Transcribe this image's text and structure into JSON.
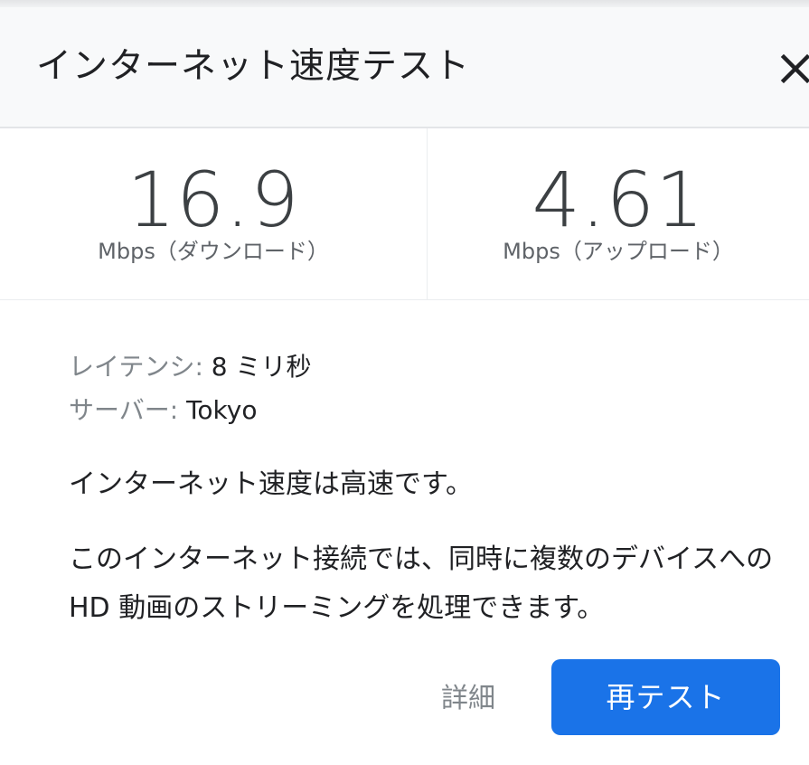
{
  "dialog": {
    "title": "インターネット速度テスト",
    "close_icon": "close-icon"
  },
  "results": {
    "download": {
      "value": "16.9",
      "unit_label": "Mbps（ダウンロード）"
    },
    "upload": {
      "value": "4.61",
      "unit_label": "Mbps（アップロード）"
    }
  },
  "info": {
    "latency_label": "レイテンシ: ",
    "latency_value": "8 ミリ秒",
    "server_label": "サーバー: ",
    "server_value": "Tokyo"
  },
  "verdict": "インターネット速度は高速です。",
  "description": "このインターネット接続では、同時に複数のデバイスへの HD 動画のストリーミングを処理できます。",
  "actions": {
    "details_label": "詳細",
    "retest_label": "再テスト"
  },
  "colors": {
    "accent": "#1a73e8",
    "header_bg": "#f8f9fa",
    "muted_text": "#80868b",
    "value_text": "#3c4043"
  }
}
